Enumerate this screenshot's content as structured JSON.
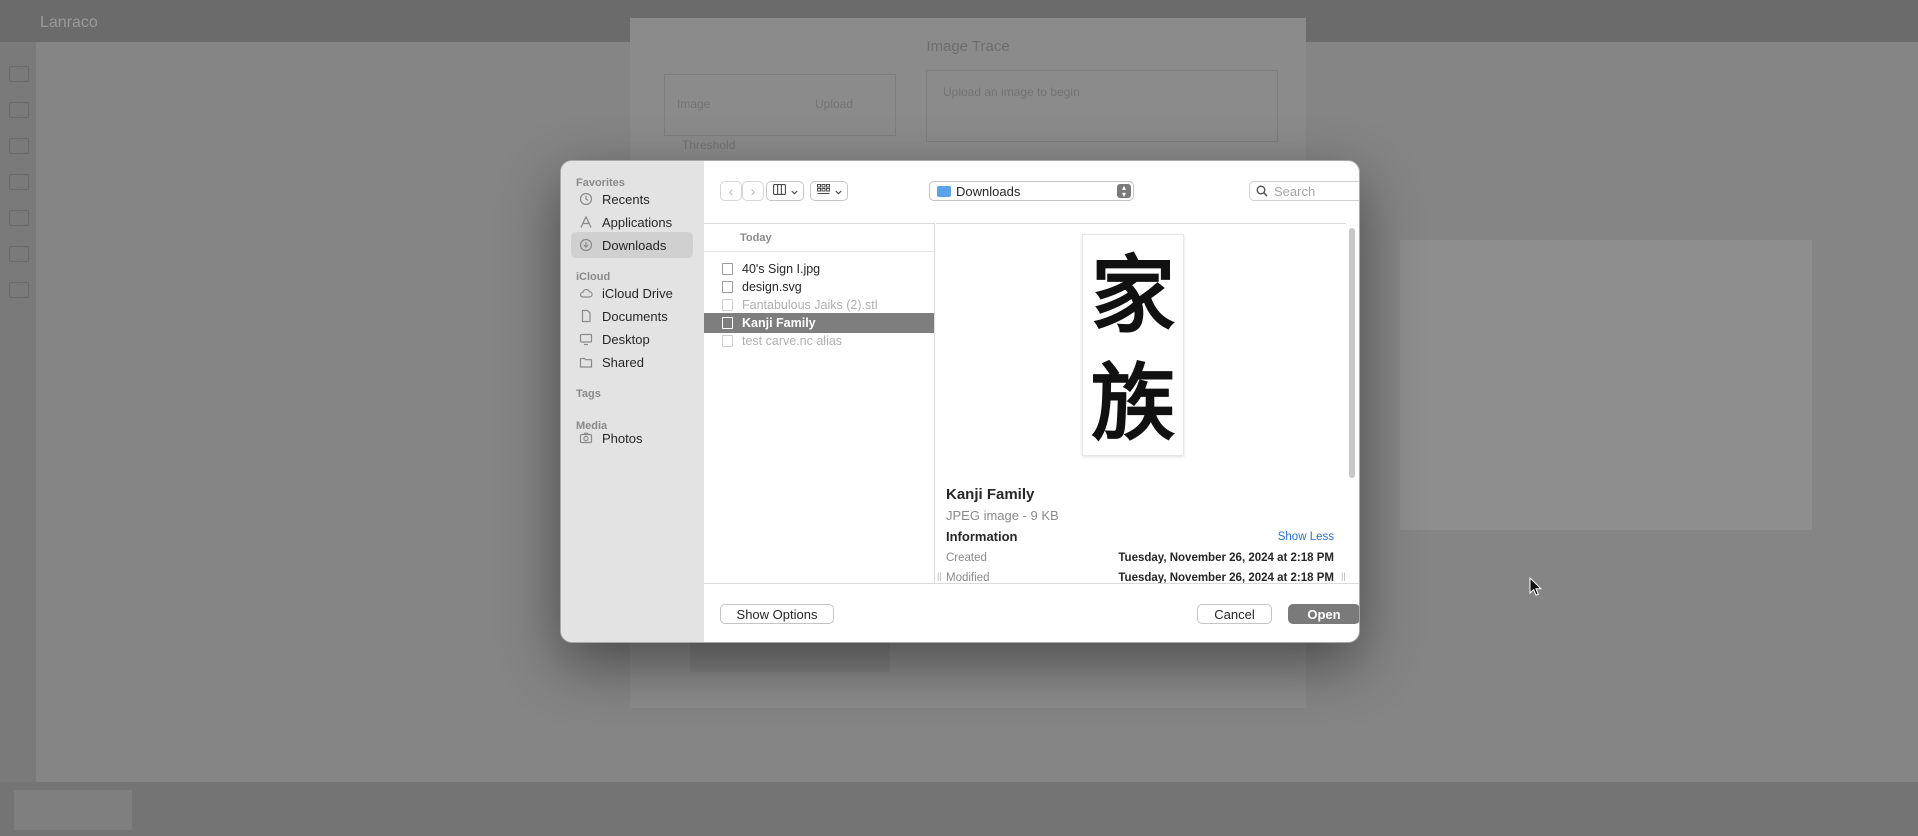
{
  "dialog": {
    "sidebar": {
      "favorites_header": "Favorites",
      "favorites": [
        {
          "label": "Recents",
          "icon": "clock-icon"
        },
        {
          "label": "Applications",
          "icon": "applications-icon"
        },
        {
          "label": "Downloads",
          "icon": "download-icon",
          "selected": true
        }
      ],
      "icloud_header": "iCloud",
      "icloud": [
        {
          "label": "iCloud Drive",
          "icon": "cloud-icon"
        },
        {
          "label": "Documents",
          "icon": "document-icon"
        },
        {
          "label": "Desktop",
          "icon": "desktop-icon"
        },
        {
          "label": "Shared",
          "icon": "shared-folder-icon"
        }
      ],
      "tags_header": "Tags",
      "media_header": "Media",
      "media": [
        {
          "label": "Photos",
          "icon": "camera-icon"
        }
      ]
    },
    "toolbar": {
      "location": "Downloads",
      "search_placeholder": "Search"
    },
    "files": {
      "group": "Today",
      "items": [
        {
          "name": "40's Sign I.jpg",
          "state": "normal"
        },
        {
          "name": "design.svg",
          "state": "normal"
        },
        {
          "name": "Fantabulous Jaiks (2).stl",
          "state": "dim"
        },
        {
          "name": "Kanji Family",
          "state": "selected"
        },
        {
          "name": "test carve.nc alias",
          "state": "dim"
        }
      ]
    },
    "preview": {
      "name": "Kanji Family",
      "kind": "JPEG image - 9 KB",
      "info_header": "Information",
      "show_less": "Show Less",
      "created_label": "Created",
      "created_value": "Tuesday, November 26, 2024 at 2:18 PM",
      "modified_label": "Modified",
      "modified_value": "Tuesday, November 26, 2024 at 2:18 PM"
    },
    "buttons": {
      "show_options": "Show Options",
      "cancel": "Cancel",
      "open": "Open"
    }
  },
  "background": {
    "app_title": "Lanraco",
    "dialog_title": "Image Trace",
    "image_label": "Image",
    "upload_label": "Upload",
    "upload_prompt": "Upload an image to begin",
    "threshold_label": "Threshold"
  },
  "colors": {
    "accent_link": "#2470d6",
    "selection": "#7e7e7e",
    "primary_button": "#7a7a7a"
  }
}
